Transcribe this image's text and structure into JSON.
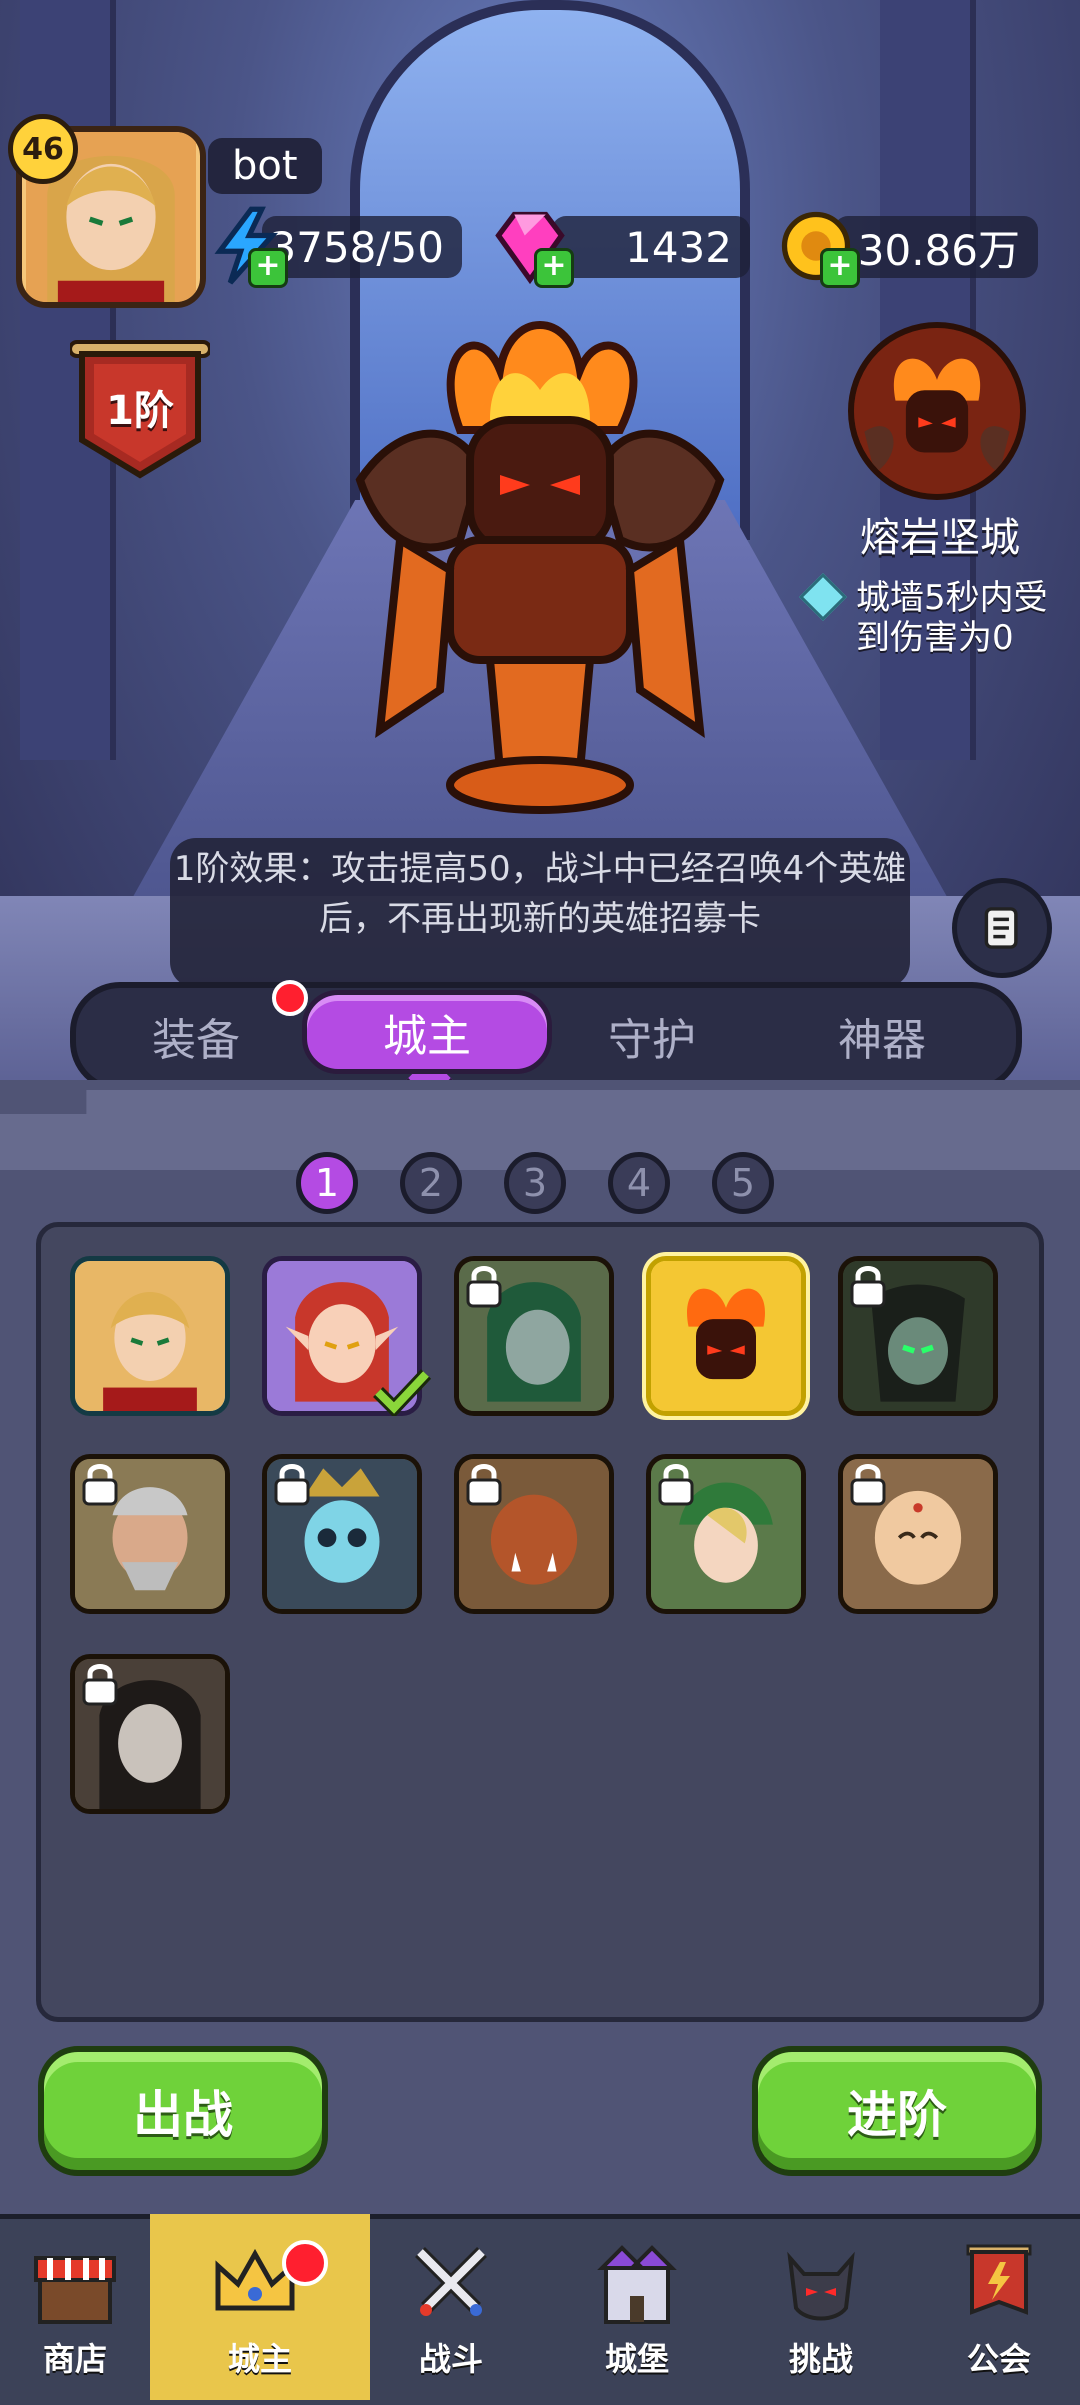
{
  "player": {
    "level": "46",
    "name": "bot",
    "rank": "1阶"
  },
  "resources": {
    "energy": "3758/50",
    "gems": "1432",
    "gold": "30.86万"
  },
  "skill": {
    "name": "熔岩坚城",
    "desc": "城墙5秒内受到伤害为0"
  },
  "effect_text": "1阶效果：攻击提高50，战斗中已经召唤4个英雄后，不再出现新的英雄招募卡",
  "tabs": [
    "装备",
    "城主",
    "守护",
    "神器"
  ],
  "pages": [
    "1",
    "2",
    "3",
    "4",
    "5"
  ],
  "heroes": [
    {
      "name": "golden-hair-knight",
      "locked": false,
      "selected": false,
      "equipped": false
    },
    {
      "name": "fire-elf",
      "locked": false,
      "selected": false,
      "equipped": true
    },
    {
      "name": "green-elf",
      "locked": true,
      "selected": false,
      "equipped": false
    },
    {
      "name": "lava-golem",
      "locked": false,
      "selected": true,
      "equipped": false
    },
    {
      "name": "shadow-demon",
      "locked": true,
      "selected": false,
      "equipped": false
    },
    {
      "name": "old-general",
      "locked": true,
      "selected": false,
      "equipped": false
    },
    {
      "name": "skull-king",
      "locked": true,
      "selected": false,
      "equipped": false
    },
    {
      "name": "orc",
      "locked": true,
      "selected": false,
      "equipped": false
    },
    {
      "name": "forest-elf",
      "locked": true,
      "selected": false,
      "equipped": false
    },
    {
      "name": "monk",
      "locked": true,
      "selected": false,
      "equipped": false
    },
    {
      "name": "dark-sage",
      "locked": true,
      "selected": false,
      "equipped": false
    }
  ],
  "buttons": {
    "battle": "出战",
    "advance": "进阶"
  },
  "nav": [
    "商店",
    "城主",
    "战斗",
    "城堡",
    "挑战",
    "公会"
  ],
  "colors": {
    "accent_purple": "#b44be3",
    "button_green": "#6fd23a",
    "nav_active": "#e9c64b"
  }
}
